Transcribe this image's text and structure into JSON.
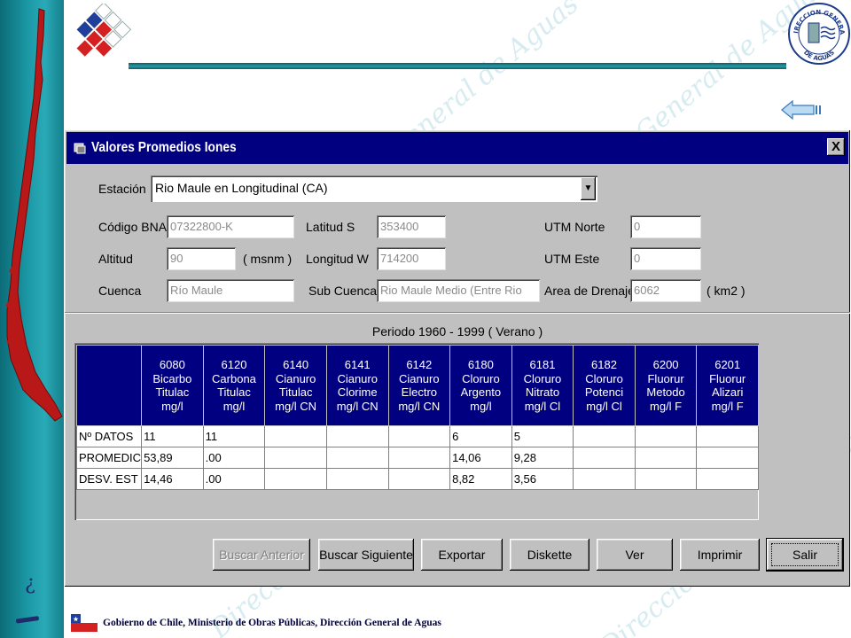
{
  "window": {
    "title": "Valores Promedios Iones",
    "close_label": "X"
  },
  "estacion": {
    "label": "Estación",
    "value": "Rio Maule en Longitudinal (CA)"
  },
  "fields": {
    "codigo_bna": {
      "label": "Código BNA",
      "value": "07322800-K"
    },
    "altitud": {
      "label": "Altitud",
      "value": "90",
      "unit": "( msnm )"
    },
    "cuenca": {
      "label": "Cuenca",
      "value": "Río Maule"
    },
    "latitud": {
      "label": "Latitud  S",
      "value": "353400"
    },
    "longitud": {
      "label": "Longitud W",
      "value": "714200"
    },
    "sub_cuenca": {
      "label": "Sub Cuenca",
      "value": "Rio Maule Medio (Entre Rio"
    },
    "utm_norte": {
      "label": "UTM Norte",
      "value": "0"
    },
    "utm_este": {
      "label": "UTM Este",
      "value": "0"
    },
    "area_drenaje": {
      "label": "Area de Drenaje",
      "value": "6062",
      "unit": "( km2 )"
    }
  },
  "periodo": "Periodo   1960 - 1999 ( Verano )",
  "table": {
    "columns": [
      {
        "l1": "6080",
        "l2": "Bicarbo",
        "l3": "Titulac",
        "l4": "mg/l"
      },
      {
        "l1": "6120",
        "l2": "Carbona",
        "l3": "Titulac",
        "l4": "mg/l"
      },
      {
        "l1": "6140",
        "l2": "Cianuro",
        "l3": "Titulac",
        "l4": "mg/l CN"
      },
      {
        "l1": "6141",
        "l2": "Cianuro",
        "l3": "Clorime",
        "l4": "mg/l CN"
      },
      {
        "l1": "6142",
        "l2": "Cianuro",
        "l3": "Electro",
        "l4": "mg/l CN"
      },
      {
        "l1": "6180",
        "l2": "Cloruro",
        "l3": "Argento",
        "l4": "mg/l"
      },
      {
        "l1": "6181",
        "l2": "Cloruro",
        "l3": "Nitrato",
        "l4": "mg/l Cl"
      },
      {
        "l1": "6182",
        "l2": "Cloruro",
        "l3": "Potenci",
        "l4": "mg/l Cl"
      },
      {
        "l1": "6200",
        "l2": "Fluorur",
        "l3": "Metodo",
        "l4": "mg/l F"
      },
      {
        "l1": "6201",
        "l2": "Fluorur",
        "l3": "Alizari",
        "l4": "mg/l F"
      }
    ],
    "rows": [
      {
        "label": "Nº DATOS",
        "cells": [
          "11",
          "11",
          "",
          "",
          "",
          "6",
          "5",
          "",
          "",
          ""
        ]
      },
      {
        "label": "PROMEDIC",
        "cells": [
          "53,89",
          ".00",
          "",
          "",
          "",
          "14,06",
          "9,28",
          "",
          "",
          ""
        ]
      },
      {
        "label": "DESV. EST",
        "cells": [
          "14,46",
          ".00",
          "",
          "",
          "",
          "8,82",
          "3,56",
          "",
          "",
          ""
        ]
      }
    ]
  },
  "buttons": {
    "buscar_anterior": "Buscar Anterior",
    "buscar_siguiente": "Buscar Siguiente",
    "exportar": "Exportar",
    "diskette": "Diskette",
    "ver": "Ver",
    "imprimir": "Imprimir",
    "salir": "Salir"
  },
  "seal": {
    "top": "DIRECCION GENERAL",
    "bottom": "DE AGUAS"
  },
  "watermark_text": "Dirección General de Aguas",
  "footer": "Gobierno de Chile, Ministerio de Obras Públicas, Dirección General de Aguas",
  "colors": {
    "titlebar": "#000080",
    "window": "#c0c0c0",
    "accent": "#1c99a6",
    "map": "#b81818"
  }
}
